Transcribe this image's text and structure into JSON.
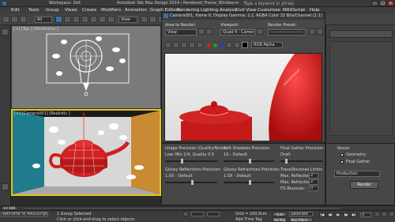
{
  "titlebar": {
    "workspace": "Workspace: Default",
    "app_title": "Autodesk 3ds Max Design 2014 x64",
    "file_title": "Rendered_Frame_Window.max",
    "search_placeholder": "Type a keyword or phrase"
  },
  "menu": [
    "Edit",
    "Tools",
    "Group",
    "Views",
    "Create",
    "Modifiers",
    "Animation",
    "Graph Editors",
    "Rendering",
    "Lighting Analysis",
    "Civil View",
    "Customize",
    "MAXScript",
    "Help"
  ],
  "toolbar": {
    "filter_value": "All",
    "view_value": "View"
  },
  "viewports": {
    "top_label": "[+] [Top ] [Wireframe ]",
    "persp_label": "[+] [Camera001] [Realistic ]"
  },
  "render_window": {
    "title": "Camera001, frame 0, Display Gamma: 2.2, RGBA Color 32 Bits/Channel (1:1)",
    "area_label": "Area to Render:",
    "area_value": "View",
    "viewport_label": "Viewport:",
    "viewport_value": "Quad 4 - Camera001",
    "preset_label": "Render Preset:",
    "preset_value": "-----------------------",
    "channel_value": "RGB Alpha"
  },
  "settings": {
    "image_precision_label": "Image Precision (Quality/Noise):",
    "image_precision_value": "Low: Min 1/4, Quality 0.5",
    "soft_shadows_label": "Soft Shadows Precision:",
    "soft_shadows_value": "1X - Default",
    "final_gather_label": "Final Gather Precision:",
    "final_gather_value": "Draft",
    "glossy_refl_label": "Glossy Reflections Precision:",
    "glossy_refl_value": "1.0X - Default",
    "glossy_refr_label": "Glossy Refractions Precision:",
    "glossy_refr_value": "1.0X - Default",
    "trace_label": "Trace/Bounces Limits",
    "max_refl_label": "Max. Reflections:",
    "max_refl_value": "2",
    "max_refr_label": "Max. Refractions:",
    "max_refr_value": "2",
    "fg_bounces_label": "FG Bounces:",
    "fg_bounces_value": "0",
    "reuse_label": "Reuse",
    "geometry_label": "Geometry",
    "final_gather_chk_label": "Final Gather",
    "production_value": "Production",
    "render_button": "Render"
  },
  "timeline": {
    "frame_counter": "0 / 100"
  },
  "status": {
    "maxscript_prompt": "Welcome to MAXScript.",
    "selection": "1 Group Selected",
    "hint": "Click or click-and-drag to select objects",
    "grid": "Grid = 100.0cm",
    "add_time_tag": "Add Time Tag",
    "autokey": "Auto Key",
    "autokey_value": "Selected",
    "setkey": "Set Key",
    "key_filters": "Key Filters...",
    "frame": "0"
  }
}
